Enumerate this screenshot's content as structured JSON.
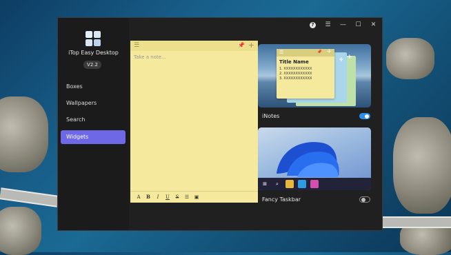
{
  "app": {
    "title": "iTop Easy Desktop",
    "version": "V2.2"
  },
  "nav": [
    {
      "label": "Boxes",
      "active": false
    },
    {
      "label": "Wallpapers",
      "active": false
    },
    {
      "label": "Search",
      "active": false
    },
    {
      "label": "Widgets",
      "active": true
    }
  ],
  "titlebar": {
    "icons": [
      "help-icon",
      "menu-icon",
      "minimize-icon",
      "maximize-icon",
      "close-icon"
    ]
  },
  "note": {
    "placeholder": "Take a note...",
    "toolbar": [
      "A",
      "B",
      "I",
      "U",
      "S",
      "list",
      "image"
    ]
  },
  "widgets": [
    {
      "name": "iNotes",
      "enabled": true,
      "preview": {
        "title": "Title  Name",
        "items": [
          "1. XXXXXXXXXXXX",
          "2. XXXXXXXXXXXX",
          "3. XXXXXXXXXXXX"
        ]
      }
    },
    {
      "name": "Fancy Taskbar",
      "enabled": false
    }
  ],
  "colors": {
    "accent": "#6f68e6",
    "toggle_on": "#2b8ee8",
    "note_bg": "#f4e99c"
  }
}
